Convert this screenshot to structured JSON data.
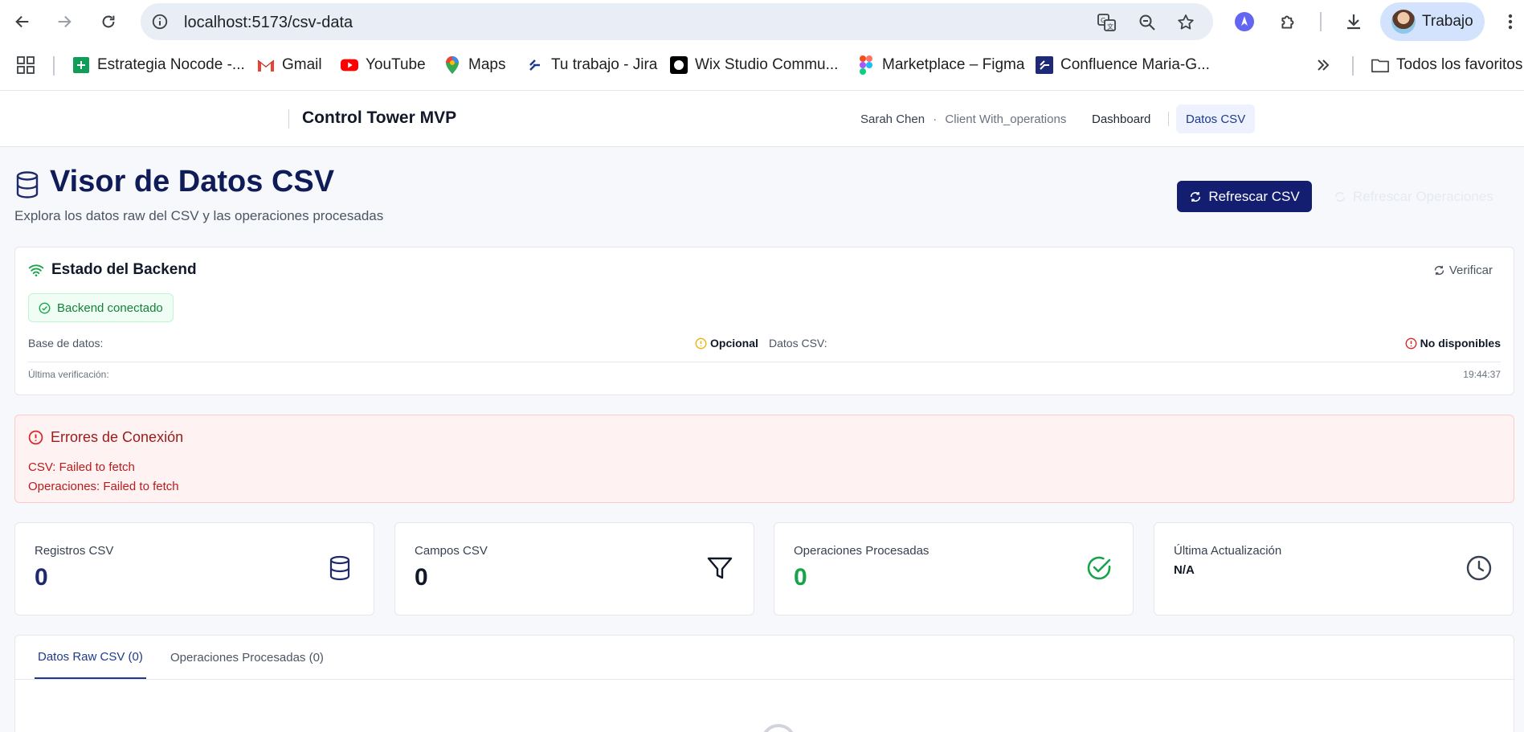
{
  "browser": {
    "url": "localhost:5173/csv-data",
    "profile_name": "Trabajo",
    "bookmarks": [
      {
        "label": "Estrategia Nocode -...",
        "icon": "sheets-icon"
      },
      {
        "label": "Gmail",
        "icon": "gmail-icon"
      },
      {
        "label": "YouTube",
        "icon": "youtube-icon"
      },
      {
        "label": "Maps",
        "icon": "maps-icon"
      },
      {
        "label": "Tu trabajo - Jira",
        "icon": "jira-icon"
      },
      {
        "label": "Wix Studio Commu...",
        "icon": "wix-icon"
      },
      {
        "label": "Marketplace – Figma",
        "icon": "figma-icon"
      },
      {
        "label": "Confluence Maria-G...",
        "icon": "confluence-icon"
      }
    ],
    "all_favorites_label": "Todos los favoritos"
  },
  "header": {
    "app_title": "Control Tower MVP",
    "user_name": "Sarah Chen",
    "separator": "·",
    "client_name": "Client With_operations",
    "nav": {
      "dashboard": "Dashboard",
      "csv": "Datos CSV"
    }
  },
  "page": {
    "title": "Visor de Datos CSV",
    "subtitle": "Explora los datos raw del CSV y las operaciones procesadas",
    "refresh_csv_label": "Refrescar CSV",
    "refresh_ops_label": "Refrescar Operaciones"
  },
  "backend": {
    "title": "Estado del Backend",
    "verify_label": "Verificar",
    "status_label": "Backend conectado",
    "db_label": "Base de datos:",
    "db_value": "Opcional",
    "csv_label": "Datos CSV:",
    "csv_value": "No disponibles",
    "last_check_label": "Última verificación:",
    "last_check_value": "19:44:37"
  },
  "errors": {
    "title": "Errores de Conexión",
    "lines": [
      "CSV: Failed to fetch",
      "Operaciones: Failed to fetch"
    ]
  },
  "stats": [
    {
      "label": "Registros CSV",
      "value": "0",
      "icon": "database-icon",
      "color": "#1e2a6b"
    },
    {
      "label": "Campos CSV",
      "value": "0",
      "icon": "filter-icon",
      "color": "#111827"
    },
    {
      "label": "Operaciones Procesadas",
      "value": "0",
      "icon": "check-circle-icon",
      "color": "#16a34a"
    },
    {
      "label": "Última Actualización",
      "value": "N/A",
      "icon": "clock-icon",
      "color": "#111827"
    }
  ],
  "tabs": [
    {
      "label": "Datos Raw CSV (0)",
      "active": true
    },
    {
      "label": "Operaciones Procesadas (0)",
      "active": false
    }
  ],
  "colors": {
    "primary": "#131e70",
    "success": "#16a34a",
    "warning": "#eab308",
    "danger": "#dc2626"
  }
}
